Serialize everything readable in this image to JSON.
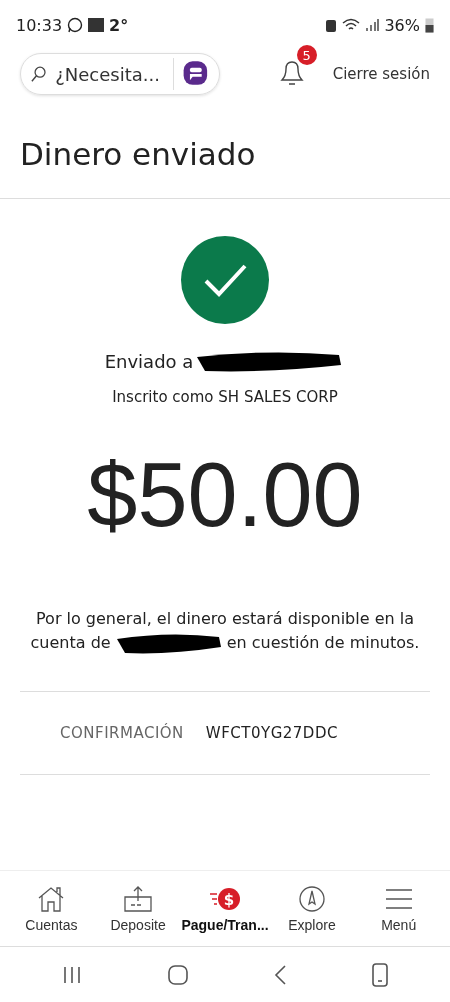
{
  "status_bar": {
    "time": "10:33",
    "temperature": "2°",
    "battery": "36%"
  },
  "header": {
    "search": {
      "placeholder": "¿Necesita..."
    },
    "notifications": {
      "count": "5"
    },
    "logout": "Cierre sesión"
  },
  "title": "Dinero enviado",
  "receipt": {
    "sent_to": "Enviado a",
    "enrolled_as": "Inscrito como SH SALES CORP",
    "amount": "$50.00",
    "note_line1": "Por lo general, el dinero estará disponible en la",
    "note_line2_start": "cuenta de",
    "note_line2_end": "en cuestión de minutos.",
    "confirmation": {
      "label": "CONFIRMACIÓN",
      "value": "WFCT0YG27DDC"
    }
  },
  "bottom_nav": [
    {
      "kind": "home",
      "label": "Cuentas",
      "selected": false
    },
    {
      "kind": "deposit",
      "label": "Deposite",
      "selected": false
    },
    {
      "kind": "pay",
      "icon_text": "$",
      "label": "Pague/Tran...",
      "selected": true
    },
    {
      "kind": "explore",
      "label": "Explore",
      "selected": false
    },
    {
      "kind": "menu",
      "label": "Menú",
      "selected": false
    }
  ]
}
